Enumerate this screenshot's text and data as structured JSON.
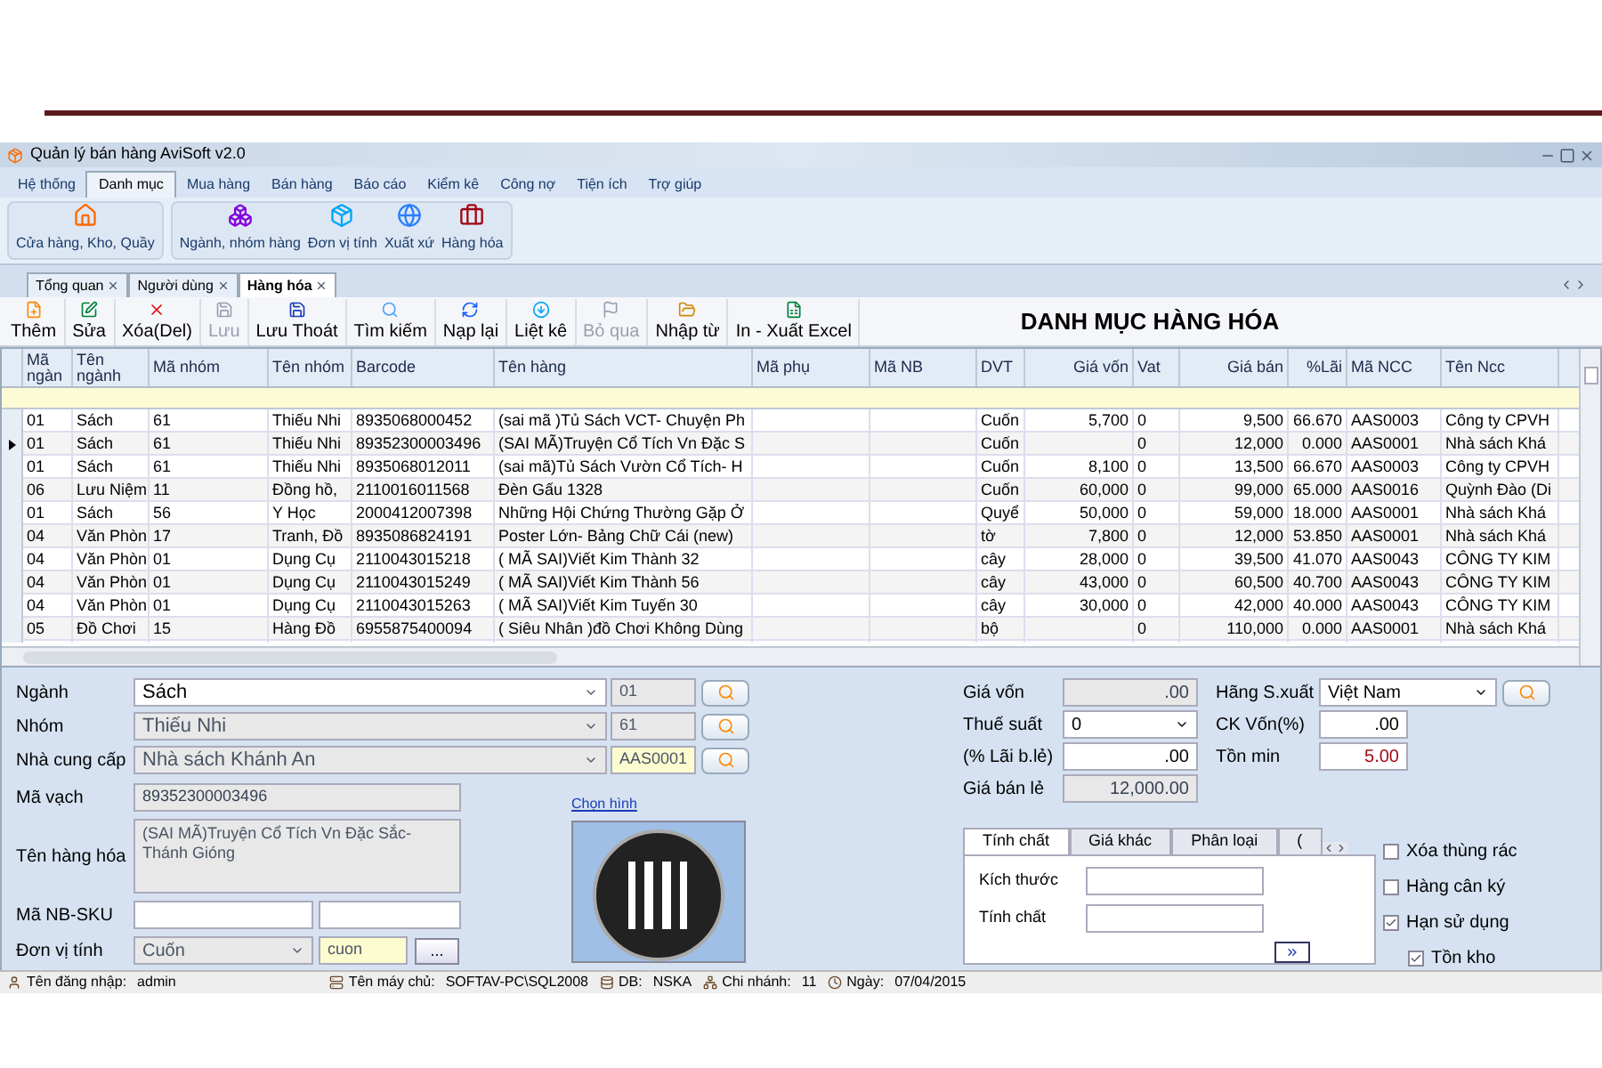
{
  "window": {
    "title": "Quản lý bán hàng AviSoft v2.0"
  },
  "menu": [
    {
      "label": "Hệ thống",
      "selected": false
    },
    {
      "label": "Danh mục",
      "selected": true
    },
    {
      "label": "Mua hàng",
      "selected": false
    },
    {
      "label": "Bán hàng",
      "selected": false
    },
    {
      "label": "Báo cáo",
      "selected": false
    },
    {
      "label": "Kiểm kê",
      "selected": false
    },
    {
      "label": "Công nợ",
      "selected": false
    },
    {
      "label": "Tiện ích",
      "selected": false
    },
    {
      "label": "Trợ giúp",
      "selected": false
    }
  ],
  "ribbon": [
    {
      "items": [
        "Cửa hàng, Kho, Quầy"
      ]
    },
    {
      "items": [
        "Ngành, nhóm hàng",
        "Đơn vị tính",
        "Xuất xứ",
        "Hàng hóa"
      ]
    }
  ],
  "doc_tabs": [
    {
      "label": "Tổng quan",
      "selected": false
    },
    {
      "label": "Người dùng",
      "selected": false
    },
    {
      "label": "Hàng hóa",
      "selected": true
    }
  ],
  "toolbar": [
    {
      "label": "Thêm",
      "disabled": false
    },
    {
      "label": "Sửa",
      "disabled": false
    },
    {
      "label": "Xóa(Del)",
      "disabled": false
    },
    {
      "label": "Lưu",
      "disabled": true
    },
    {
      "label": "Lưu Thoát",
      "disabled": false
    },
    {
      "label": "Tìm kiếm",
      "disabled": false
    },
    {
      "label": "Nạp lại",
      "disabled": false
    },
    {
      "label": "Liệt kê",
      "disabled": false
    },
    {
      "label": "Bỏ qua",
      "disabled": true
    },
    {
      "label": "Nhập từ",
      "disabled": false
    },
    {
      "label": "In - Xuất Excel",
      "disabled": false
    }
  ],
  "page_title": "DANH MỤC HÀNG HÓA",
  "table": {
    "columns": [
      {
        "label": "Mã ngàn",
        "numeric": false
      },
      {
        "label": "Tên ngành",
        "numeric": false
      },
      {
        "label": "Mã nhóm",
        "numeric": false
      },
      {
        "label": "Tên nhóm",
        "numeric": false
      },
      {
        "label": "Barcode",
        "numeric": false
      },
      {
        "label": "Tên hàng",
        "numeric": false
      },
      {
        "label": "Mã phụ",
        "numeric": false
      },
      {
        "label": "Mã NB",
        "numeric": false
      },
      {
        "label": "DVT",
        "numeric": false
      },
      {
        "label": "Giá vốn",
        "numeric": true
      },
      {
        "label": "Vat",
        "numeric": false
      },
      {
        "label": "Giá bán",
        "numeric": true
      },
      {
        "label": "%Lãi",
        "numeric": true
      },
      {
        "label": "Mã NCC",
        "numeric": false
      },
      {
        "label": "Tên Ncc",
        "numeric": false
      }
    ],
    "rows": [
      {
        "selected": false,
        "cells": [
          "01",
          "Sách",
          "61",
          "Thiếu Nhi",
          "8935068000452",
          "(sai mã )Tủ Sách VCT- Chuyện Ph",
          "",
          "",
          "Cuốn",
          "5,700",
          "0",
          "9,500",
          "66.670",
          "AAS0003",
          "Công ty CPVH"
        ]
      },
      {
        "selected": true,
        "cells": [
          "01",
          "Sách",
          "61",
          "Thiếu Nhi",
          "89352300003496",
          "(SAI MÃ)Truyện Cổ Tích Vn Đặc S",
          "",
          "",
          "Cuốn",
          "",
          "0",
          "12,000",
          "0.000",
          "AAS0001",
          "Nhà sách  Khá"
        ]
      },
      {
        "selected": false,
        "cells": [
          "01",
          "Sách",
          "61",
          "Thiếu Nhi",
          "8935068012011",
          "(sai mã)Tủ Sách Vườn Cổ Tích- H",
          "",
          "",
          "Cuốn",
          "8,100",
          "0",
          "13,500",
          "66.670",
          "AAS0003",
          "Công ty CPVH"
        ]
      },
      {
        "selected": false,
        "cells": [
          "06",
          "Lưu Niệm",
          "11",
          "Đồng hồ,",
          "2110016011568",
          "Đèn Gấu 1328",
          "",
          "",
          "Cuốn",
          "60,000",
          "0",
          "99,000",
          "65.000",
          "AAS0016",
          "Quỳnh Đào (Di"
        ]
      },
      {
        "selected": false,
        "cells": [
          "01",
          "Sách",
          "56",
          "Y Học",
          "2000412007398",
          "Những Hội Chứng Thường Gặp Ở",
          "",
          "",
          "Quyể",
          "50,000",
          "0",
          "59,000",
          "18.000",
          "AAS0001",
          "Nhà sách  Khá"
        ]
      },
      {
        "selected": false,
        "cells": [
          "04",
          "Văn Phòn",
          "17",
          "Tranh, Đồ",
          "8935086824191",
          "Poster Lớn- Bảng Chữ Cái (new)",
          "",
          "",
          "tờ",
          "7,800",
          "0",
          "12,000",
          "53.850",
          "AAS0001",
          "Nhà sách  Khá"
        ]
      },
      {
        "selected": false,
        "cells": [
          "04",
          "Văn Phòn",
          "01",
          "Dụng Cụ",
          "2110043015218",
          "( MÃ SAI)Viết Kim Thành 32",
          "",
          "",
          "cây",
          "28,000",
          "0",
          "39,500",
          "41.070",
          "AAS0043",
          "CÔNG TY KIM"
        ]
      },
      {
        "selected": false,
        "cells": [
          "04",
          "Văn Phòn",
          "01",
          "Dụng Cụ",
          "2110043015249",
          "( MÃ SAI)Viết Kim Thành 56",
          "",
          "",
          "cây",
          "43,000",
          "0",
          "60,500",
          "40.700",
          "AAS0043",
          "CÔNG TY KIM"
        ]
      },
      {
        "selected": false,
        "cells": [
          "04",
          "Văn Phòn",
          "01",
          "Dụng Cụ",
          "2110043015263",
          "( MÃ SAI)Viết Kim Tuyến 30",
          "",
          "",
          "cây",
          "30,000",
          "0",
          "42,000",
          "40.000",
          "AAS0043",
          "CÔNG TY KIM"
        ]
      },
      {
        "selected": false,
        "cells": [
          "05",
          "Đồ Chơi",
          "15",
          "Hàng Đồ",
          "6955875400094",
          "( Siêu Nhân )đồ Chơi Không Dùng",
          "",
          "",
          "bộ",
          "",
          "0",
          "110,000",
          "0.000",
          "AAS0001",
          "Nhà sách  Khá"
        ]
      }
    ]
  },
  "form": {
    "lookups": [
      {
        "label": "Ngành",
        "value": "Sách",
        "code": "01",
        "disabled": false,
        "highlighted": false
      },
      {
        "label": "Nhóm",
        "value": "Thiếu Nhi",
        "code": "61",
        "disabled": true,
        "highlighted": false
      },
      {
        "label": "Nhà cung cấp",
        "value": "Nhà sách  Khánh An",
        "code": "AAS0001",
        "disabled": true,
        "highlighted": true
      }
    ],
    "barcode": {
      "label": "Mã vạch",
      "value": "89352300003496"
    },
    "name": {
      "label": "Tên hàng hóa",
      "value": "(SAI MÃ)Truyện Cổ Tích Vn Đặc Sắc- Thánh Gióng"
    },
    "sku": {
      "label": "Mã NB-SKU"
    },
    "unit": {
      "label": "Đơn vị tính",
      "value": "Cuốn",
      "code": "cuon",
      "button": "..."
    },
    "image_link": "Chọn hình",
    "prices": [
      {
        "label": "Giá vốn",
        "value": ".00",
        "kind": "readonly"
      },
      {
        "label": "Thuế suất",
        "value": "0",
        "kind": "combo"
      },
      {
        "label": "(% Lãi b.lẻ)",
        "value": ".00",
        "kind": "input"
      },
      {
        "label": "Giá bán lẻ",
        "value": "12,000.00",
        "kind": "readonly"
      }
    ],
    "maker": {
      "label": "Hãng S.xuất",
      "value": "Việt Nam"
    },
    "ck": {
      "label": "CK Vốn(%)",
      "value": ".00"
    },
    "min_stock": {
      "label": "Tồn min",
      "value": "5.00"
    },
    "tabs": [
      {
        "label": "Tính chất",
        "selected": true
      },
      {
        "label": "Giá khác",
        "selected": false
      },
      {
        "label": "Phân loại",
        "selected": false
      },
      {
        "label": "(",
        "selected": false
      }
    ],
    "tab_fields": [
      {
        "label": "Kích thước"
      },
      {
        "label": "Tính chất"
      }
    ],
    "checks": [
      {
        "label": "Xóa thùng rác",
        "checked": false
      },
      {
        "label": "Hàng cân ký",
        "checked": false
      },
      {
        "label": "Hạn sử dụng",
        "checked": true
      },
      {
        "label": "Tồn kho",
        "checked": true
      }
    ]
  },
  "status_bar": [
    {
      "label": "Tên đăng nhập:",
      "value": "admin"
    },
    {
      "label": "Tên máy chủ:",
      "value": "SOFTAV-PC\\SQL2008"
    },
    {
      "label": "DB:",
      "value": "NSKA"
    },
    {
      "label": "Chi nhánh:",
      "value": "11"
    },
    {
      "label": "Ngày:",
      "value": "07/04/2015"
    }
  ]
}
